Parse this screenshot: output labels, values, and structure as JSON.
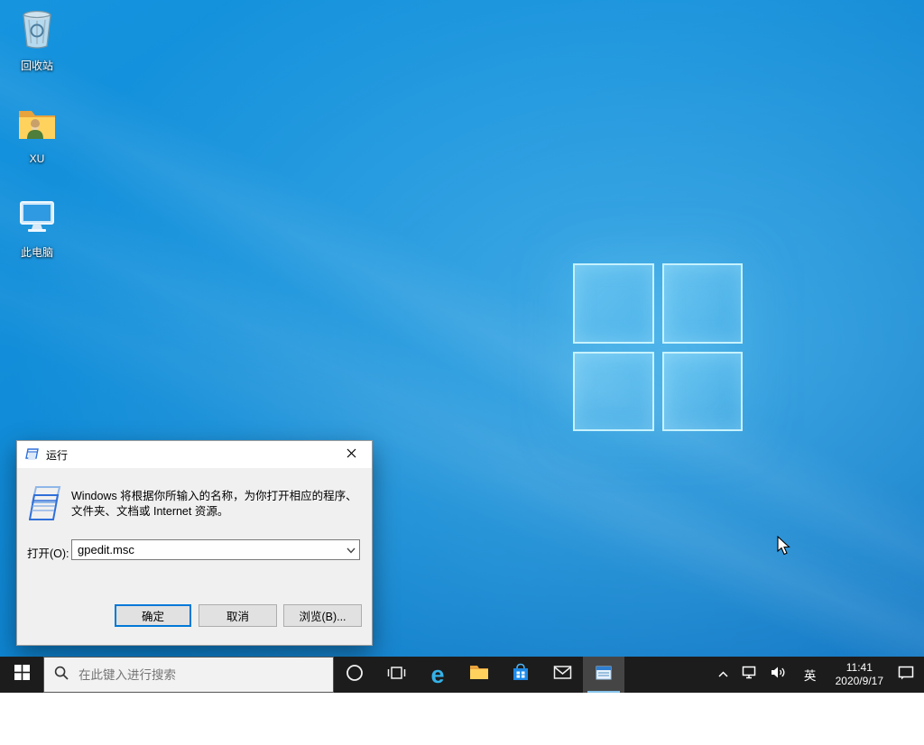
{
  "colors": {
    "accent": "#0078d7",
    "taskbar": "#1c1c1c",
    "wallpaper_blue": "#0e86d2"
  },
  "desktop": {
    "icons": [
      {
        "id": "recycle-bin",
        "label": "回收站"
      },
      {
        "id": "user-folder",
        "label": "XU"
      },
      {
        "id": "this-pc",
        "label": "此电脑"
      }
    ]
  },
  "run_dialog": {
    "title": "运行",
    "description_line1": "Windows 将根据你所输入的名称，为你打开相应的程序、",
    "description_line2": "文件夹、文档或 Internet 资源。",
    "open_label": "打开(O):",
    "input_value": "gpedit.msc",
    "buttons": {
      "ok": "确定",
      "cancel": "取消",
      "browse": "浏览(B)..."
    }
  },
  "taskbar": {
    "search": {
      "placeholder": "在此键入进行搜索"
    },
    "icons": {
      "edge_glyph": "e"
    },
    "tray": {
      "input_indicator": "英",
      "time": "11:41",
      "date": "2020/9/17"
    }
  }
}
